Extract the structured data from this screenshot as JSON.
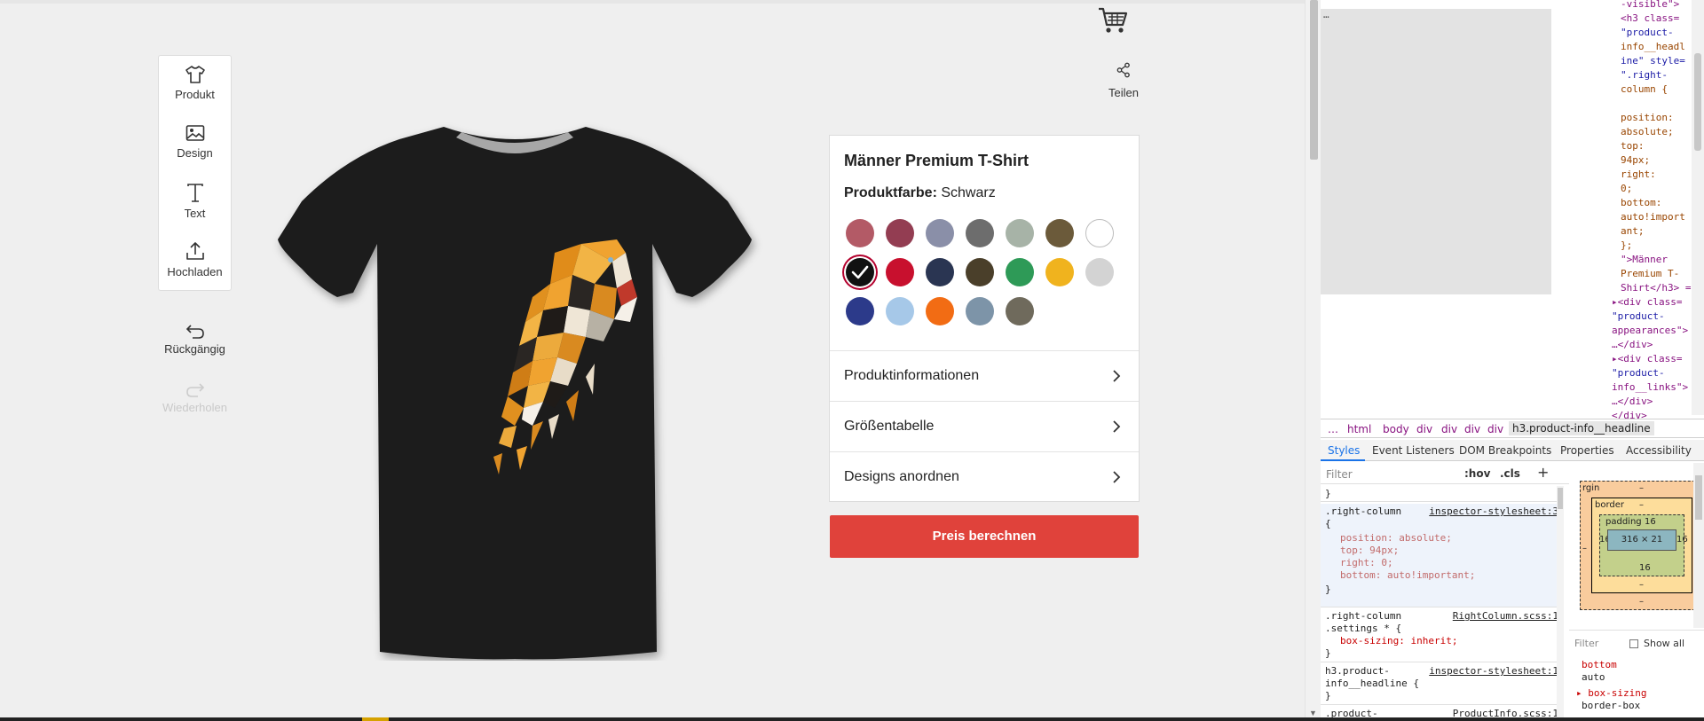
{
  "editor": {
    "tools": [
      {
        "label": "Produkt",
        "icon": "tshirt-icon"
      },
      {
        "label": "Design",
        "icon": "image-icon"
      },
      {
        "label": "Text",
        "icon": "text-icon"
      },
      {
        "label": "Hochladen",
        "icon": "upload-icon"
      }
    ],
    "undo_label": "Rückgängig",
    "redo_label": "Wiederholen",
    "share_label": "Teilen",
    "cart_icon": "cart-icon"
  },
  "product": {
    "headline": "Männer Premium T-Shirt",
    "color_label": "Produktfarbe:",
    "color_value": "Schwarz",
    "tshirt_color": "#1c1c1c",
    "swatches": [
      {
        "color": "#b35a66"
      },
      {
        "color": "#933d52"
      },
      {
        "color": "#8a8fa8"
      },
      {
        "color": "#6d6d6d"
      },
      {
        "color": "#a7b3a7"
      },
      {
        "color": "#6b5a3a"
      },
      {
        "color": "#ffffff"
      },
      {
        "color": "#111111",
        "selected": true
      },
      {
        "color": "#c8102e"
      },
      {
        "color": "#2a3552"
      },
      {
        "color": "#4a3f2a"
      },
      {
        "color": "#2e9a57"
      },
      {
        "color": "#f0b31e"
      },
      {
        "color": "#d3d3d3"
      },
      {
        "color": "#2c3a8a"
      },
      {
        "color": "#a6c8e8"
      },
      {
        "color": "#f26c14"
      },
      {
        "color": "#7d94a8"
      },
      {
        "color": "#6f6a5c"
      }
    ],
    "accordions": [
      {
        "label": "Produktinformationen"
      },
      {
        "label": "Größentabelle"
      },
      {
        "label": "Designs anordnen"
      }
    ],
    "cta_label": "Preis berechnen",
    "cta_color": "#e0423b"
  },
  "devtools": {
    "dom_lines": [
      "-visible\">",
      "<h3 class=",
      "\"product-",
      "info__headl",
      "ine\" style=",
      "\".right-",
      "column {",
      "",
      "position:",
      "absolute;",
      "top:",
      "94px;",
      "right:",
      "0;",
      "bottom:",
      "auto!import",
      "ant;",
      "};",
      "\">Männer",
      "Premium T-",
      "Shirt</h3> =",
      "▸<div class=",
      "\"product-",
      "appearances\">",
      "…</div>",
      "▸<div class=",
      "\"product-",
      "info__links\">",
      "…</div>",
      "</div>"
    ],
    "breadcrumbs": [
      "…",
      "html",
      "body",
      "div",
      "div",
      "div",
      "div",
      "h3.product-info__headline"
    ],
    "tabs": [
      "Styles",
      "Event Listeners",
      "DOM Breakpoints",
      "Properties",
      "Accessibility"
    ],
    "filter_placeholder": "Filter",
    "hov_label": ":hov",
    "cls_label": ".cls",
    "plus_label": "+",
    "rules": {
      "r0_close": "}",
      "r1_selector": ".right-column",
      "r1_source": "inspector-stylesheet:3",
      "r1_open": "{",
      "r1_p1": "position: absolute;",
      "r1_p2": "top: 94px;",
      "r1_p3": "right: 0;",
      "r1_p4": "bottom: auto!important;",
      "r1_close": "}",
      "r2_selector1": ".right-column",
      "r2_selector2": ".settings * {",
      "r2_source": "RightColumn.scss:1",
      "r2_p1": "box-sizing: inherit;",
      "r2_close": "}",
      "r3_selector1": "h3.product-",
      "r3_selector2": "info__headline {",
      "r3_source": "inspector-stylesheet:1",
      "r3_close": "}",
      "r4_selector": ".product-",
      "r4_source": "ProductInfo.scss:1"
    },
    "boxmodel": {
      "margin_label": "rgin",
      "margin_value": "–",
      "border_label": "border",
      "border_value": "–",
      "padding_label": "padding",
      "padding_top": "16",
      "padding_left": "16",
      "padding_right": "16",
      "padding_bottom": "16",
      "content_size": "316 × 21",
      "border_bottom": "–",
      "margin_bottom": "–",
      "margin_left": "–",
      "margin_right": "–"
    },
    "computed": {
      "filter": "Filter",
      "show_all": "Show all",
      "p1": "bottom",
      "v1": "auto",
      "p2": "▸ box-sizing",
      "v2": "border-box"
    }
  }
}
